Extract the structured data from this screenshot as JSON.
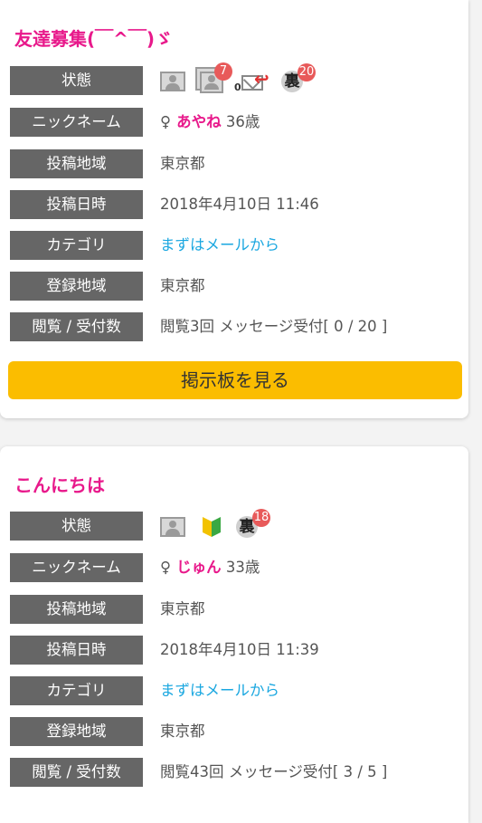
{
  "posts": [
    {
      "title": "友達募集(￣^￣)ゞ",
      "labels": {
        "status": "状態",
        "nickname": "ニックネーム",
        "post_area": "投稿地域",
        "post_datetime": "投稿日時",
        "category": "カテゴリ",
        "registered_area": "登録地域",
        "views": "閲覧 / 受付数"
      },
      "status_icons": {
        "photo": "photo-icon",
        "multi_photo": "multi-photo-icon",
        "multi_photo_count": "7",
        "mail_count": "0",
        "ura": "裏",
        "ura_count": "20"
      },
      "gender_symbol": "♀",
      "nickname": "あやね",
      "age": "36歳",
      "post_area": "東京都",
      "post_datetime": "2018年4月10日 11:46",
      "category": "まずはメールから",
      "registered_area": "東京都",
      "views": "閲覧3回 メッセージ受付[ 0 / 20 ]",
      "button": "掲示板を見る"
    },
    {
      "title": "こんにちは",
      "labels": {
        "status": "状態",
        "nickname": "ニックネーム",
        "post_area": "投稿地域",
        "post_datetime": "投稿日時",
        "category": "カテゴリ",
        "registered_area": "登録地域",
        "views": "閲覧 / 受付数"
      },
      "status_icons": {
        "photo": "photo-icon",
        "beginner": "beginner-mark-icon",
        "ura": "裏",
        "ura_count": "18"
      },
      "gender_symbol": "♀",
      "nickname": "じゅん",
      "age": "33歳",
      "post_area": "東京都",
      "post_datetime": "2018年4月10日 11:39",
      "category": "まずはメールから",
      "registered_area": "東京都",
      "views": "閲覧43回 メッセージ受付[ 3 / 5 ]"
    }
  ],
  "colors": {
    "title": "#e8198b",
    "label_bg": "#666666",
    "link": "#1aa7e0",
    "button_bg": "#fbbd00",
    "badge": "#e85a5a"
  }
}
